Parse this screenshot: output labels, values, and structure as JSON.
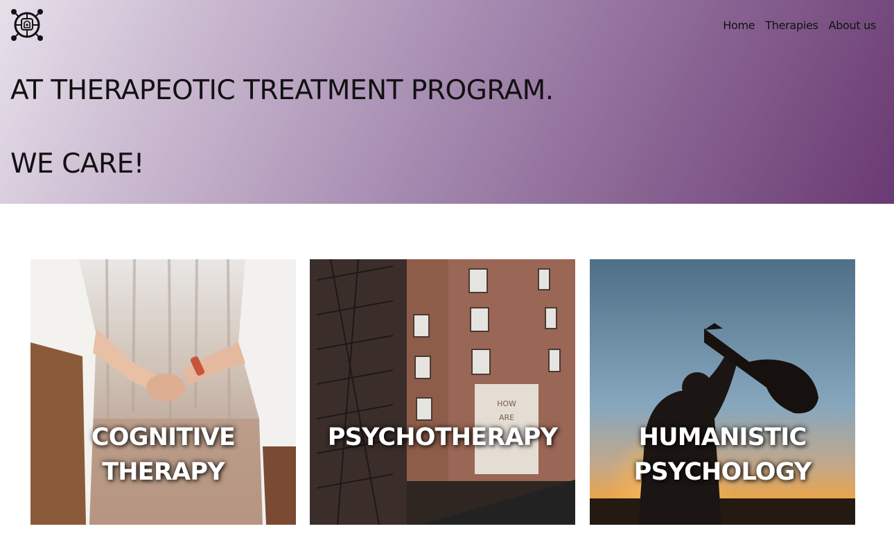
{
  "header": {
    "logo_icon": "globe-bell-logo",
    "nav": [
      {
        "label": "Home"
      },
      {
        "label": "Therapies"
      },
      {
        "label": "About us"
      }
    ]
  },
  "hero": {
    "line1": "AT THERAPEOTIC TREATMENT PROGRAM.",
    "line2": "WE CARE!",
    "gradient_start": "#e7e0ea",
    "gradient_end": "#6a3a72"
  },
  "cards": [
    {
      "title": "COGNITIVE THERAPY",
      "image": "holding-hands-photo"
    },
    {
      "title": "PSYCHOTHERAPY",
      "image": "brick-building-how-are-you-photo"
    },
    {
      "title": "HUMANISTIC PSYCHOLOGY",
      "image": "guitar-silhouette-sunset-photo"
    }
  ]
}
